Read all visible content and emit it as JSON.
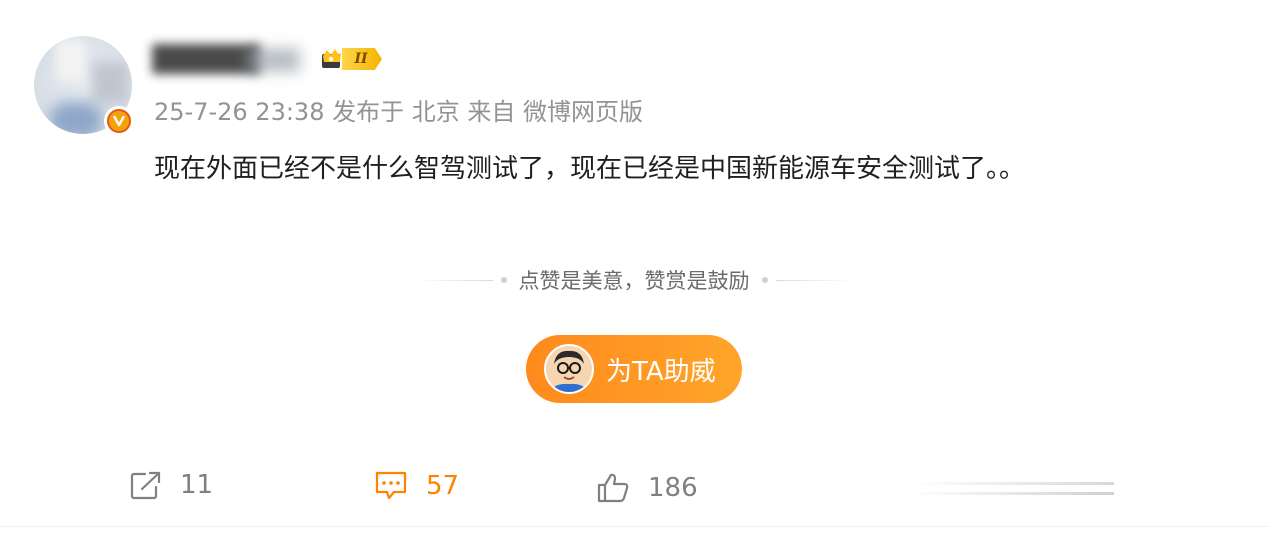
{
  "post": {
    "meta": "25-7-26 23:38 发布于 北京 来自 微博网页版",
    "text": "现在外面已经不是什么智驾测试了，现在已经是中国新能源车安全测试了。。"
  },
  "author": {
    "vip_level": "II"
  },
  "reward": {
    "slogan": "点赞是美意，赞赏是鼓励",
    "button_label": "为TA助威"
  },
  "actions": {
    "share_count": "11",
    "comment_count": "57",
    "like_count": "186"
  },
  "colors": {
    "accent": "#ff8200",
    "meta_gray": "#939393",
    "button_gradient_start": "#ff8a1c",
    "button_gradient_end": "#ffa52a"
  },
  "icons": [
    "verified-badge-icon",
    "vip-crown-icon",
    "share-icon",
    "comment-icon",
    "like-icon"
  ]
}
